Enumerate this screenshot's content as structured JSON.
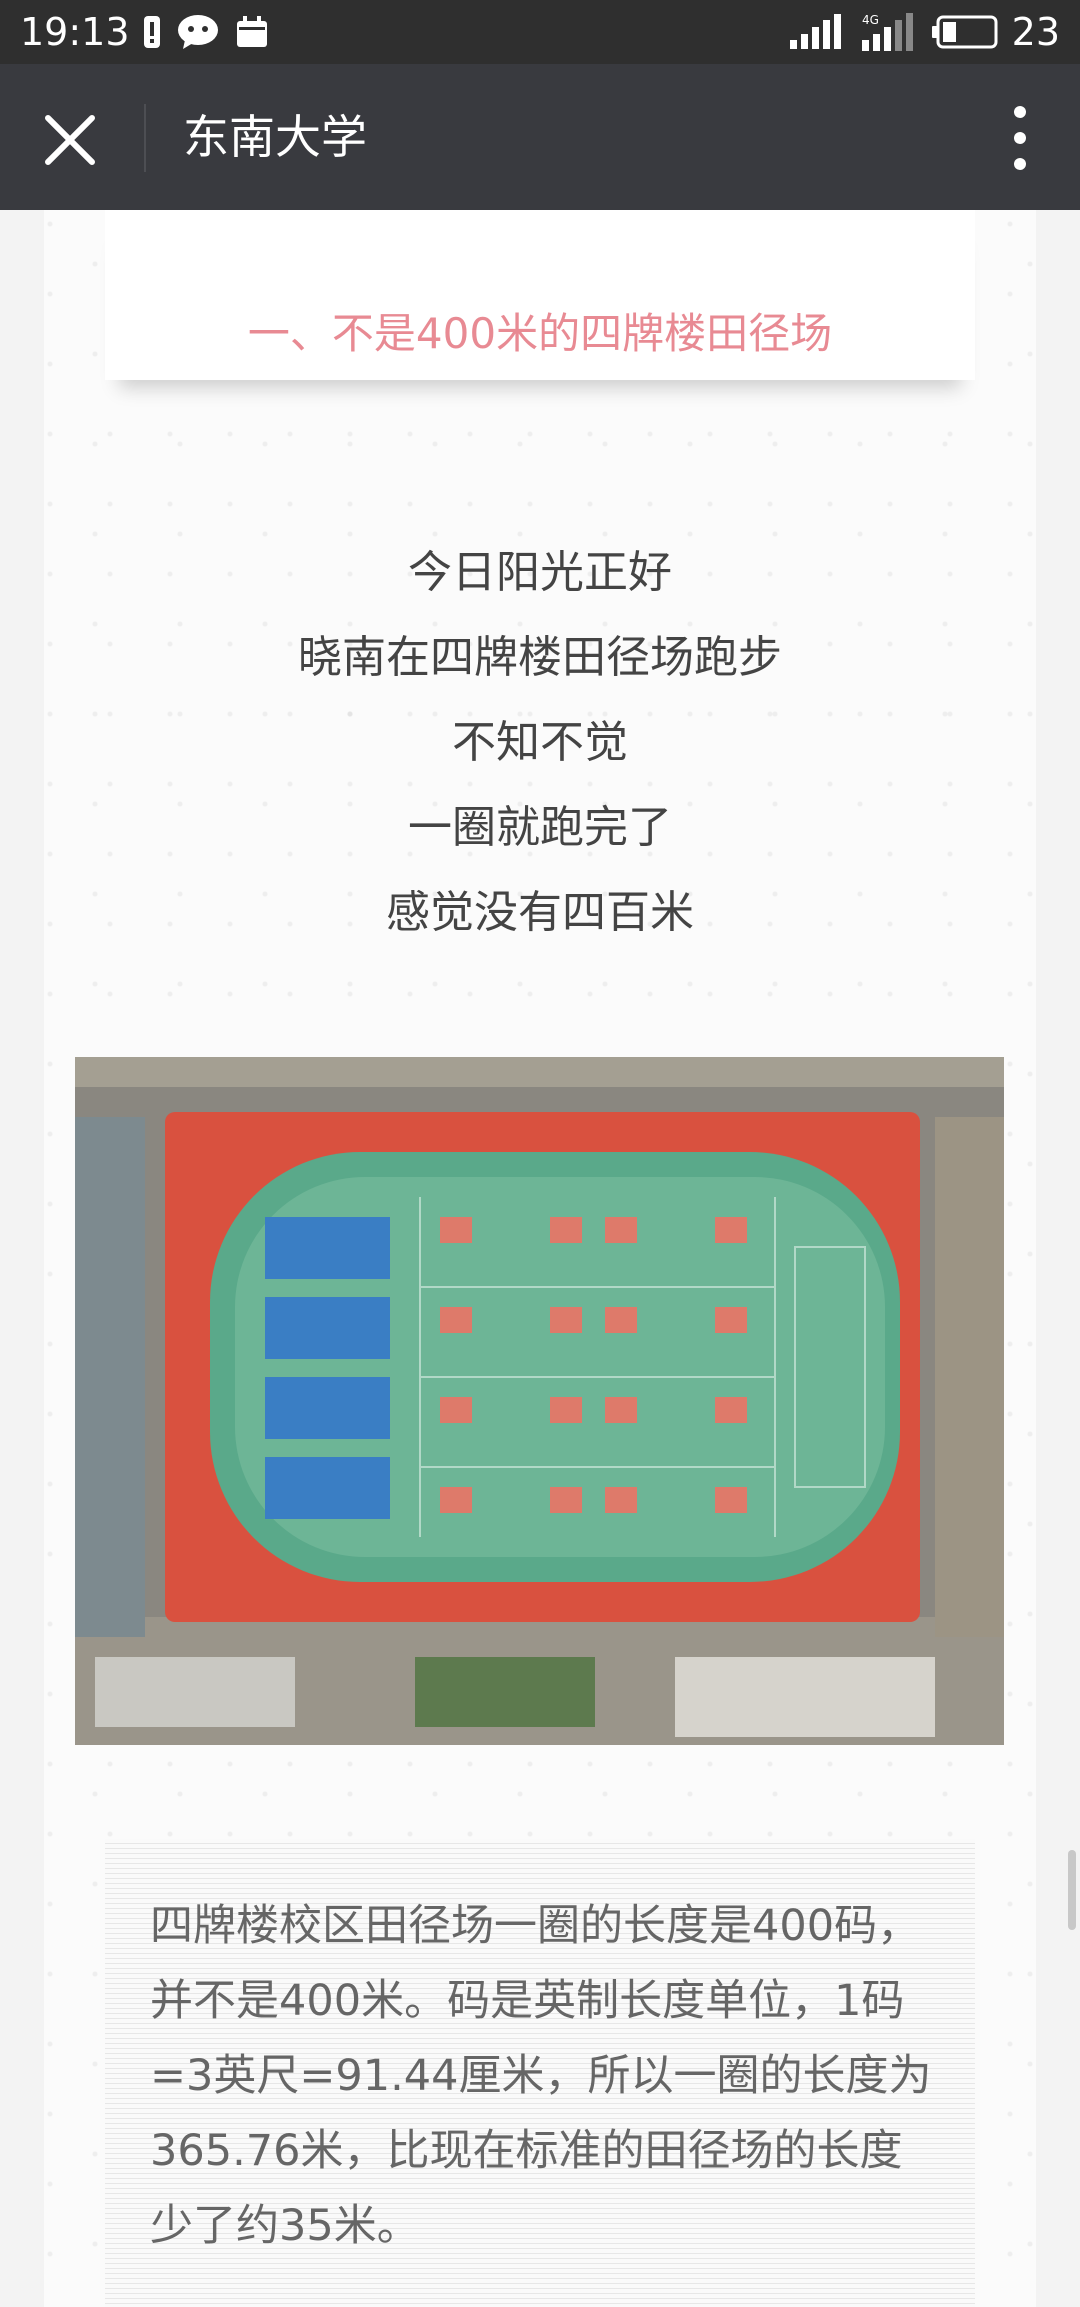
{
  "status_bar": {
    "time": "19:13",
    "network": "4G",
    "battery": "23"
  },
  "title_bar": {
    "title": "东南大学"
  },
  "article": {
    "section_heading": "一、不是400米的四牌楼田径场",
    "poem_lines": [
      "今日阳光正好",
      "晓南在四牌楼田径场跑步",
      "不知不觉",
      "一圈就跑完了",
      "感觉没有四百米"
    ],
    "caption": "四牌楼校区田径场一圈的长度是400码，并不是400米。码是英制长度单位，1码=3英尺=91.44厘米，所以一圈的长度为365.76米，比现在标准的田径场的长度少了约35米。"
  },
  "colors": {
    "heading": "#e88a93",
    "titlebar": "#393a3f",
    "statusbar": "#2f2f2f",
    "track": "#d9513f",
    "field": "#5aa98a",
    "tennis": "#3a7ec4"
  },
  "icons": {
    "close": "close-icon",
    "more": "more-vertical-icon"
  }
}
